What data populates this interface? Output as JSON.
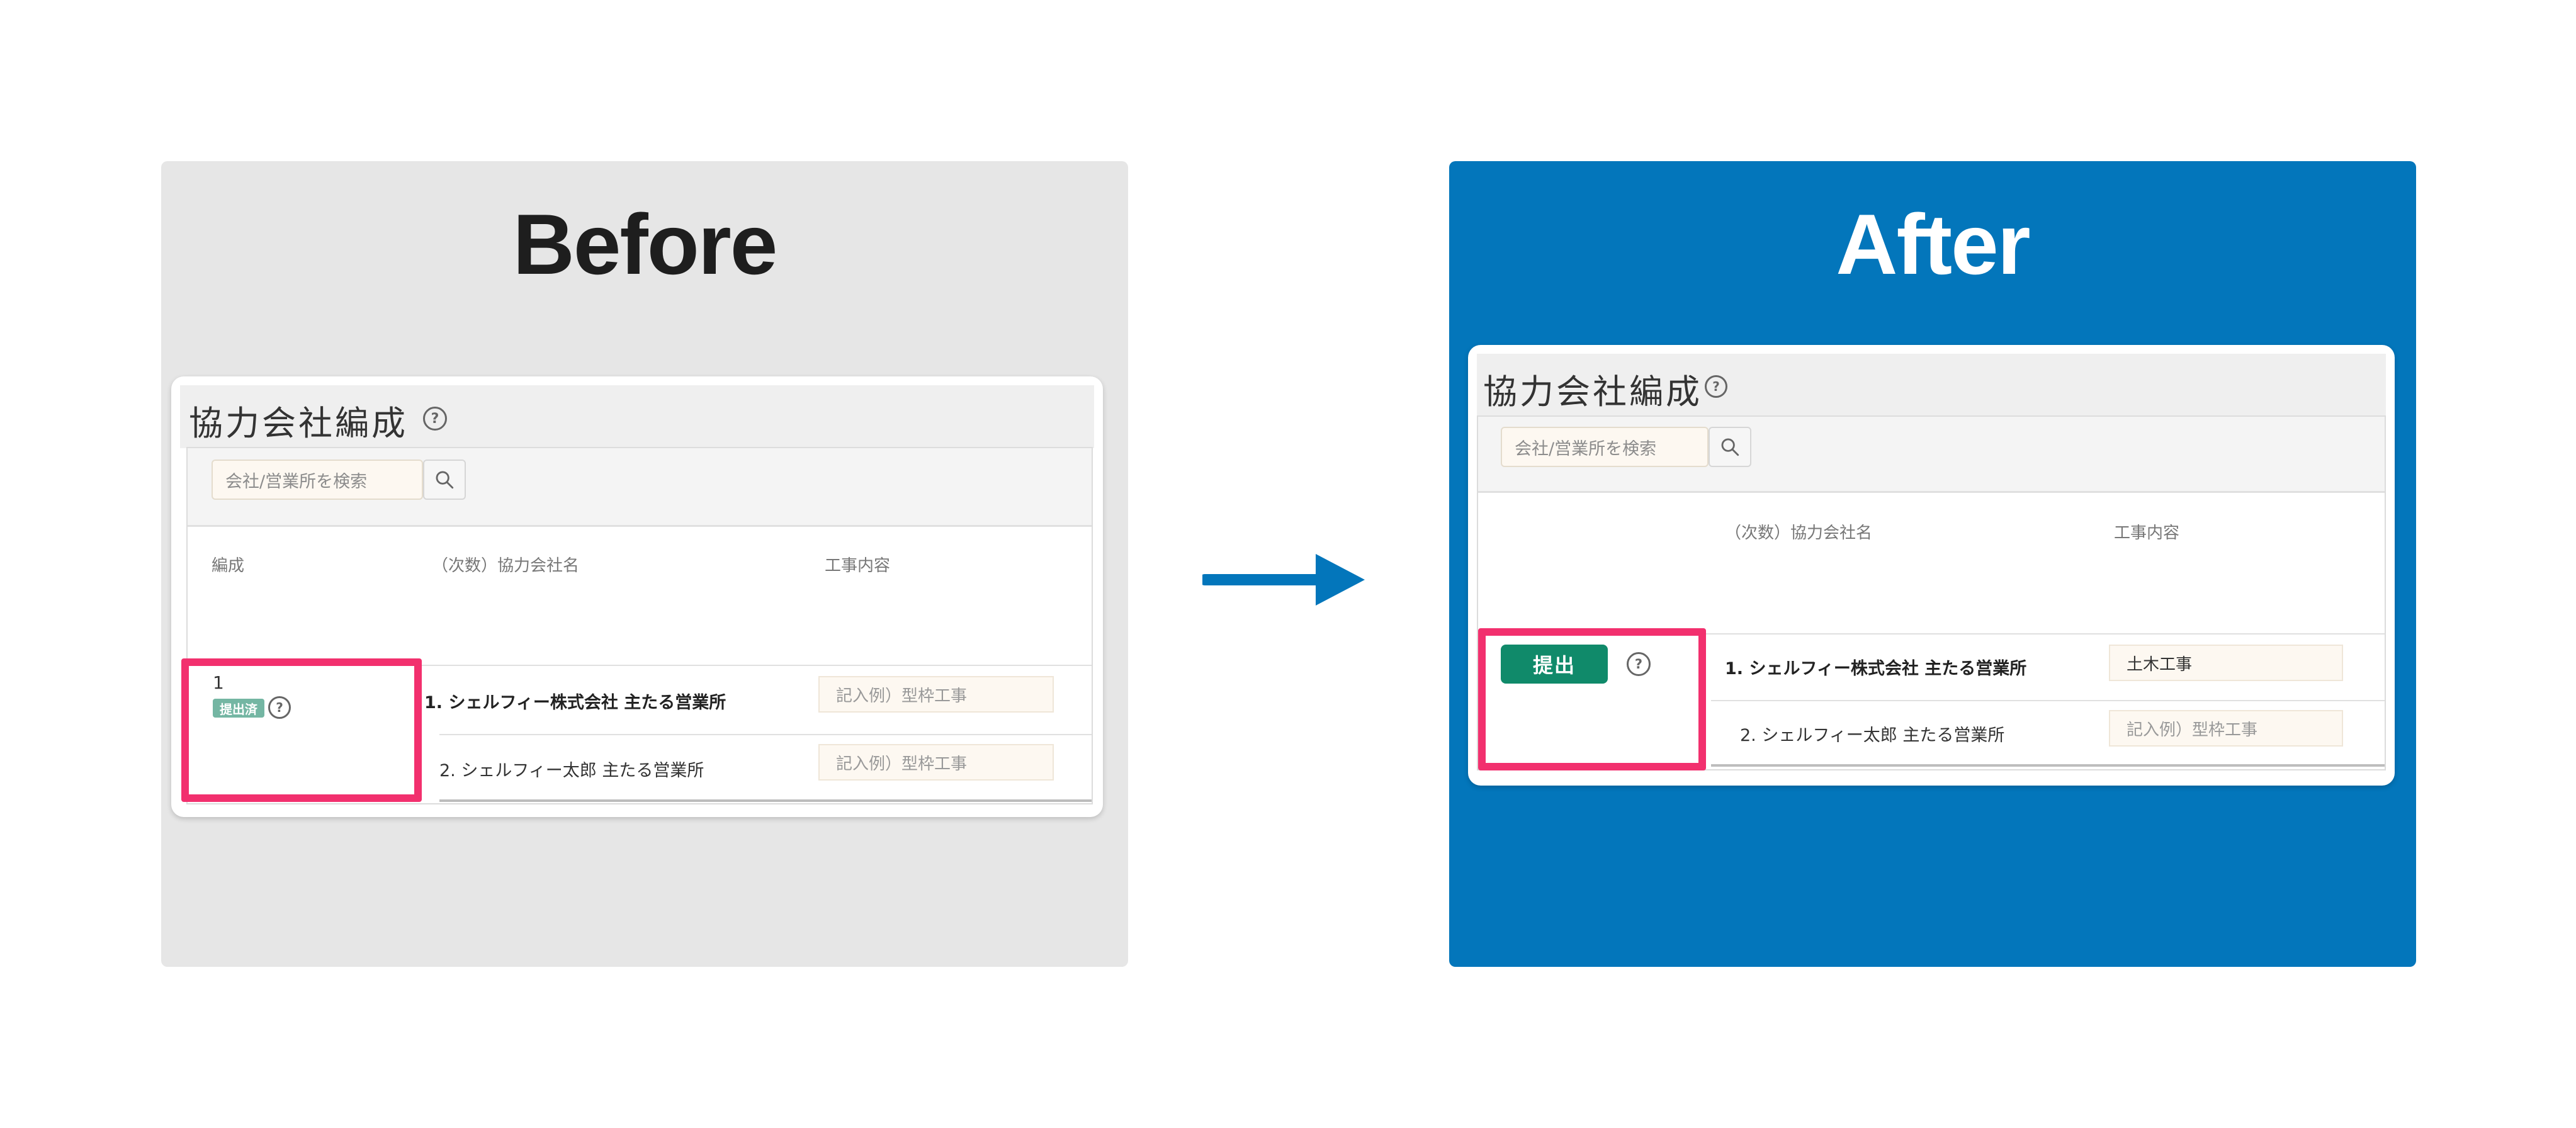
{
  "before": {
    "label": "Before",
    "card": {
      "title": "協力会社編成",
      "help_icon": "?",
      "search_placeholder": "会社/営業所を検索",
      "columns": {
        "formation": "編成",
        "company": "（次数）協力会社名",
        "work": "工事内容"
      },
      "entry": {
        "number": "1",
        "status_badge": "提出済",
        "help_icon": "?"
      },
      "rows": [
        {
          "name": "1. シェルフィー株式会社 主たる営業所",
          "work": "記入例）型枠工事"
        },
        {
          "name": "2. シェルフィー太郎 主たる営業所",
          "work": "記入例）型枠工事"
        }
      ]
    }
  },
  "after": {
    "label": "After",
    "card": {
      "title": "協力会社編成",
      "help_icon": "?",
      "search_placeholder": "会社/営業所を検索",
      "columns": {
        "company": "（次数）協力会社名",
        "work": "工事内容"
      },
      "entry": {
        "submit_label": "提出",
        "help_icon": "?"
      },
      "rows": [
        {
          "name": "1. シェルフィー株式会社 主たる営業所",
          "work": "土木工事"
        },
        {
          "name": "2. シェルフィー太郎 主たる営業所",
          "work": "記入例）型枠工事"
        }
      ]
    }
  },
  "colors": {
    "before_bg": "#e6e6e6",
    "after_bg": "#0376bb",
    "arrow": "#0376bb",
    "highlight": "#f2306e",
    "submit_button": "#108a6a",
    "status_badge": "#74b6a3"
  },
  "icons": {
    "search": "search-icon",
    "help": "help-circle-icon",
    "arrow": "arrow-right-icon"
  }
}
